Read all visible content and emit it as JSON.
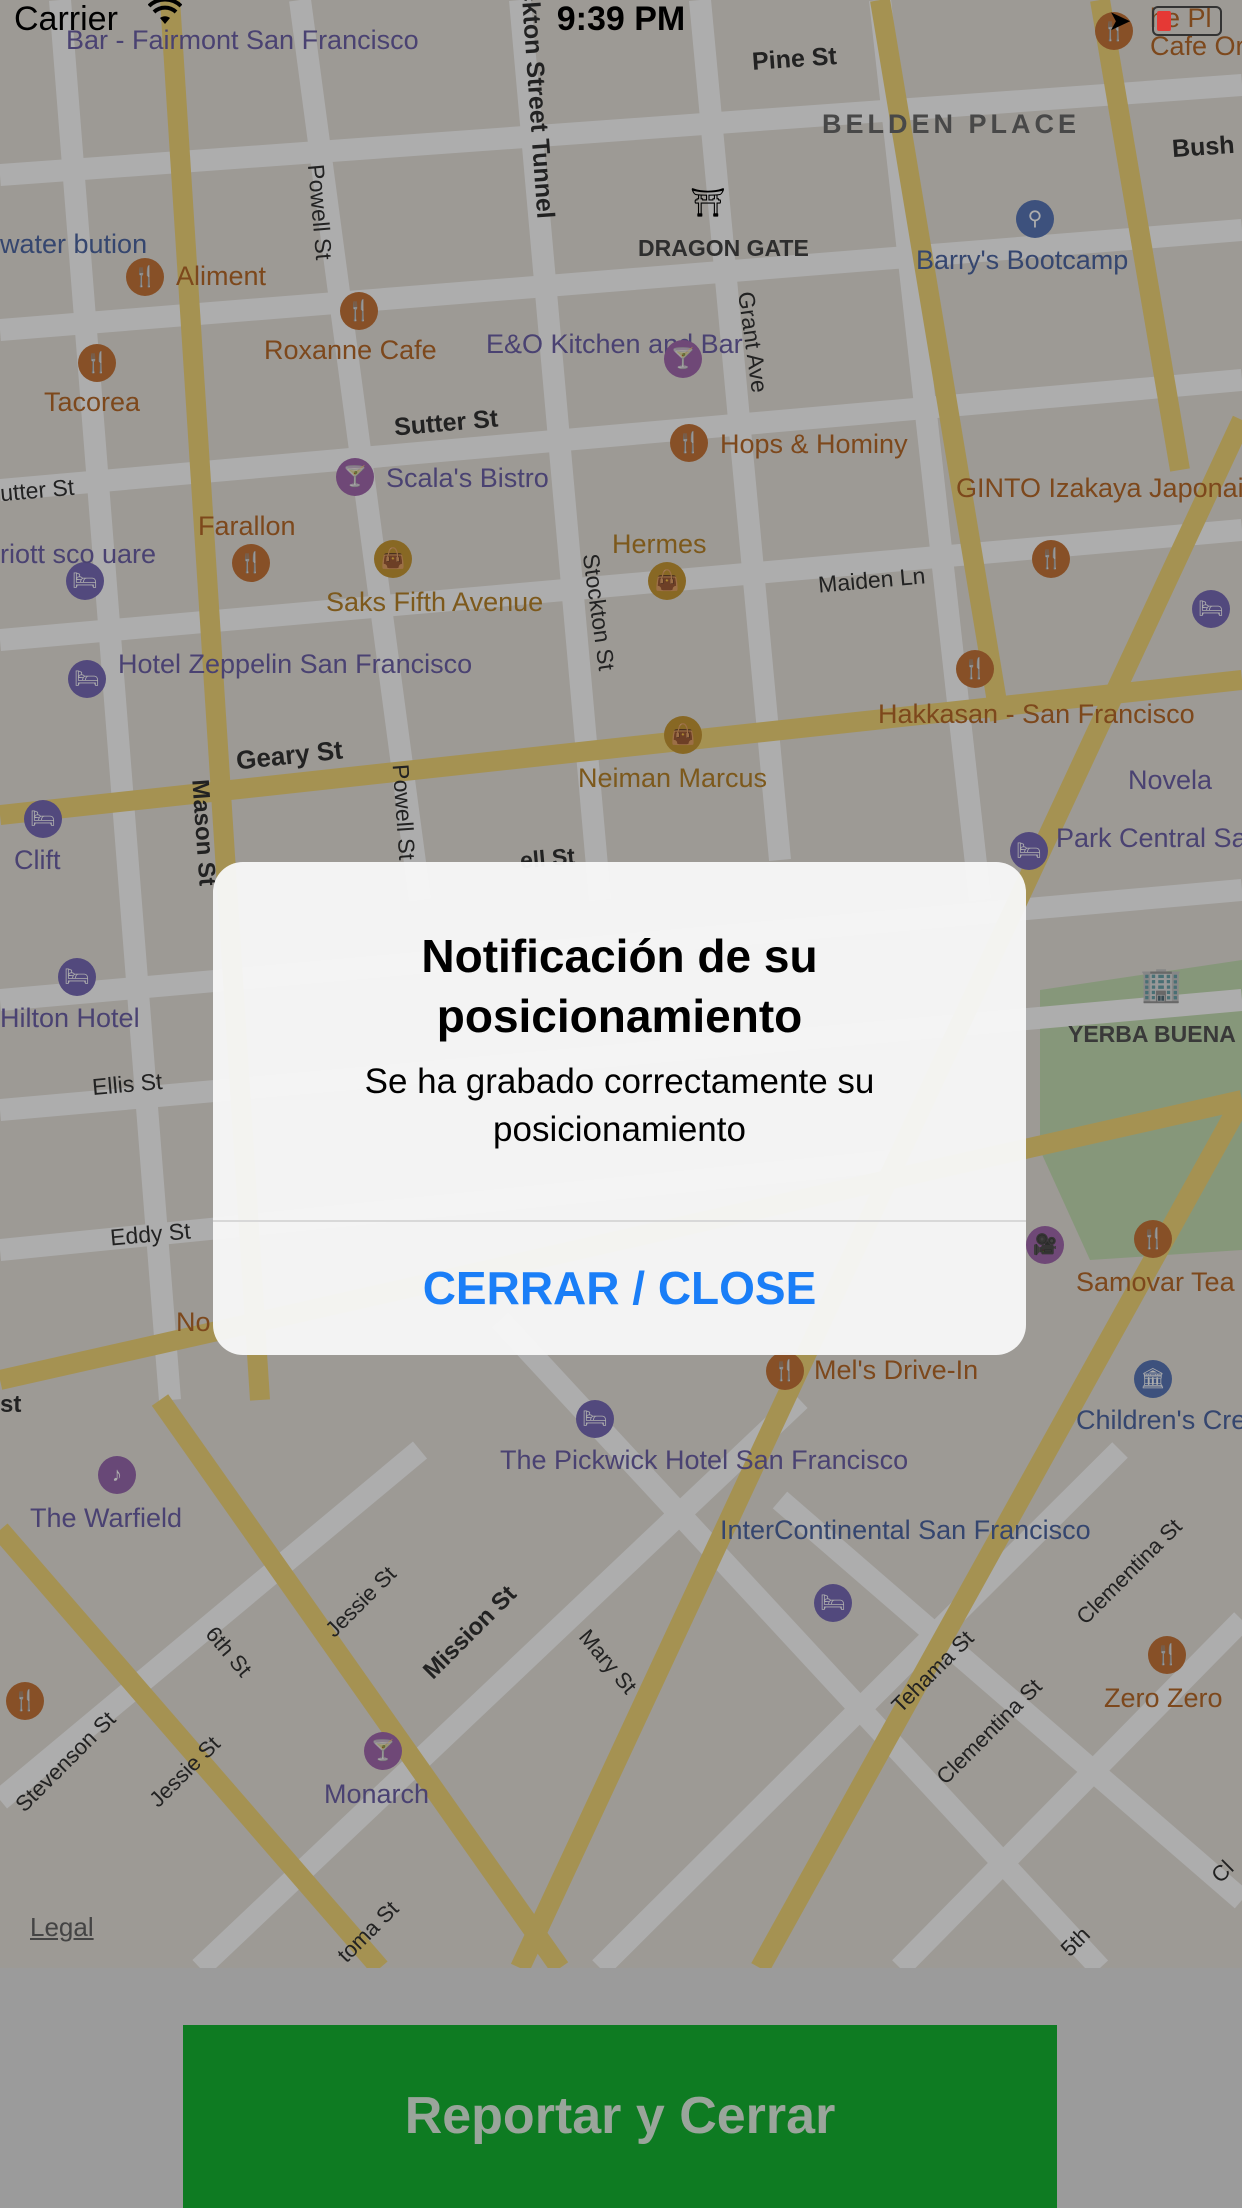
{
  "status_bar": {
    "carrier": "Carrier",
    "time": "9:39 PM"
  },
  "map": {
    "legal": "Legal",
    "areas": [
      "BELDEN PLACE",
      "DRAGON GATE"
    ],
    "streets": [
      "Pine St",
      "Bush",
      "Powell St",
      "Stockton Street Tunnel",
      "Grant Ave",
      "Sutter St",
      "utter St",
      "Stockton St",
      "Maiden Ln",
      "Geary St",
      "Mason St",
      "Powell St",
      "ell St",
      "Ellis St",
      "Eddy St",
      "Jessie St",
      "Mission St",
      "6th St",
      "Jessie St",
      "Stevenson St",
      "Mary St",
      "Tehama St",
      "Clementina St",
      "Clementina St",
      "toma St",
      "5th",
      "Cl",
      "st"
    ],
    "pois": [
      {
        "name": "Bar - Fairmont San Francisco",
        "kind": "bar"
      },
      {
        "name": "Cafe Or",
        "kind": "food"
      },
      {
        "name": "Aliment",
        "kind": "food"
      },
      {
        "name": "Roxanne Cafe",
        "kind": "food"
      },
      {
        "name": "E&O Kitchen and Bar",
        "kind": "bar"
      },
      {
        "name": "Tacorea",
        "kind": "food"
      },
      {
        "name": "Barry's Bootcamp",
        "kind": "place"
      },
      {
        "name": "Hops & Hominy",
        "kind": "food"
      },
      {
        "name": "Scala's Bistro",
        "kind": "bar"
      },
      {
        "name": "GINTO Izakaya Japonaise",
        "kind": "food"
      },
      {
        "name": "Farallon",
        "kind": "food"
      },
      {
        "name": "Hermes",
        "kind": "shop"
      },
      {
        "name": "Saks Fifth Avenue",
        "kind": "shop"
      },
      {
        "name": "Hotel Zeppelin San Francisco",
        "kind": "hotel"
      },
      {
        "name": "Hakkasan - San Francisco",
        "kind": "food"
      },
      {
        "name": "Neiman Marcus",
        "kind": "shop"
      },
      {
        "name": "Novela",
        "kind": "bar"
      },
      {
        "name": "Clift",
        "kind": "hotel"
      },
      {
        "name": "Park Central San Francisco",
        "kind": "hotel"
      },
      {
        "name": "Hilton Hotel",
        "kind": "hotel"
      },
      {
        "name": "YERBA BUENA CENTER FOR THE ARTS",
        "kind": "area"
      },
      {
        "name": "Samovar Tea Lounge",
        "kind": "food"
      },
      {
        "name": "Mel's Drive-In",
        "kind": "food"
      },
      {
        "name": "Children's Creativity Museum",
        "kind": "place"
      },
      {
        "name": "The Pickwick Hotel San Francisco",
        "kind": "hotel"
      },
      {
        "name": "The Warfield",
        "kind": "music"
      },
      {
        "name": "InterContinental San Francisco",
        "kind": "hotel"
      },
      {
        "name": "Zero Zero",
        "kind": "food"
      },
      {
        "name": "Monarch",
        "kind": "bar"
      },
      {
        "name": "water bution",
        "kind": "place"
      },
      {
        "name": "riott sco uare",
        "kind": "hotel"
      },
      {
        "name": "No",
        "kind": "food"
      },
      {
        "name": "he Pl",
        "kind": "food"
      }
    ]
  },
  "alert": {
    "title": "Notificación de su posicionamiento",
    "message": "Se ha grabado correctamente su posicionamiento",
    "button_label": "CERRAR / CLOSE"
  },
  "bottom": {
    "report_button_label": "Reportar y Cerrar"
  },
  "colors": {
    "alert_button": "#1a7ef7",
    "report_button_bg": "#0e7b22",
    "report_button_text": "#9aa59b"
  }
}
